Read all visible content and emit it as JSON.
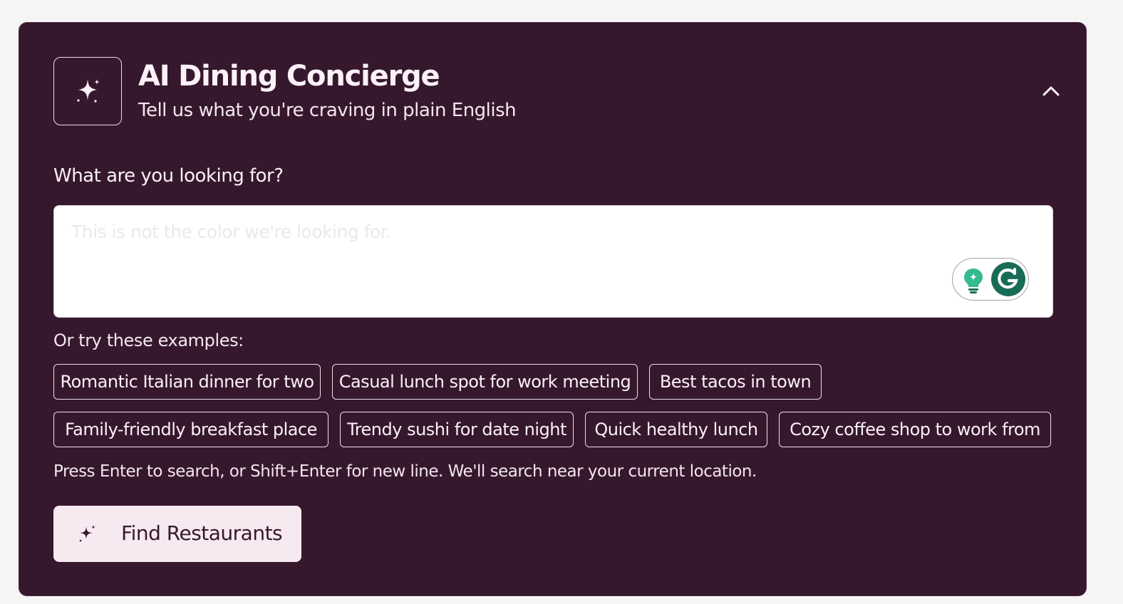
{
  "header": {
    "title": "AI Dining Concierge",
    "subtitle": "Tell us what you're craving in plain English",
    "logo_icon": "sparkles-icon",
    "collapse_icon": "chevron-up-icon"
  },
  "query": {
    "label": "What are you looking for?",
    "value": "",
    "placeholder": "This is not the color we're looking for."
  },
  "examples": {
    "label": "Or try these examples:",
    "items": [
      "Romantic Italian dinner for two",
      "Casual lunch spot for work meeting",
      "Best tacos in town",
      "Family-friendly breakfast place",
      "Trendy sushi for date night",
      "Quick healthy lunch",
      "Cozy coffee shop to work from"
    ]
  },
  "hint": "Press Enter to search, or Shift+Enter for new line. We'll search near your current location.",
  "find_button": {
    "label": "Find Restaurants",
    "icon": "sparkles-icon"
  },
  "extension": {
    "icons": [
      "lightbulb-icon",
      "grammarly-icon"
    ],
    "brand_color": "#176b57",
    "accent_color": "#35b991"
  },
  "colors": {
    "card_background": "#36182e",
    "page_background": "#f6f4f5",
    "button_background": "#f6e9f0",
    "text": "#fbf1f6"
  }
}
